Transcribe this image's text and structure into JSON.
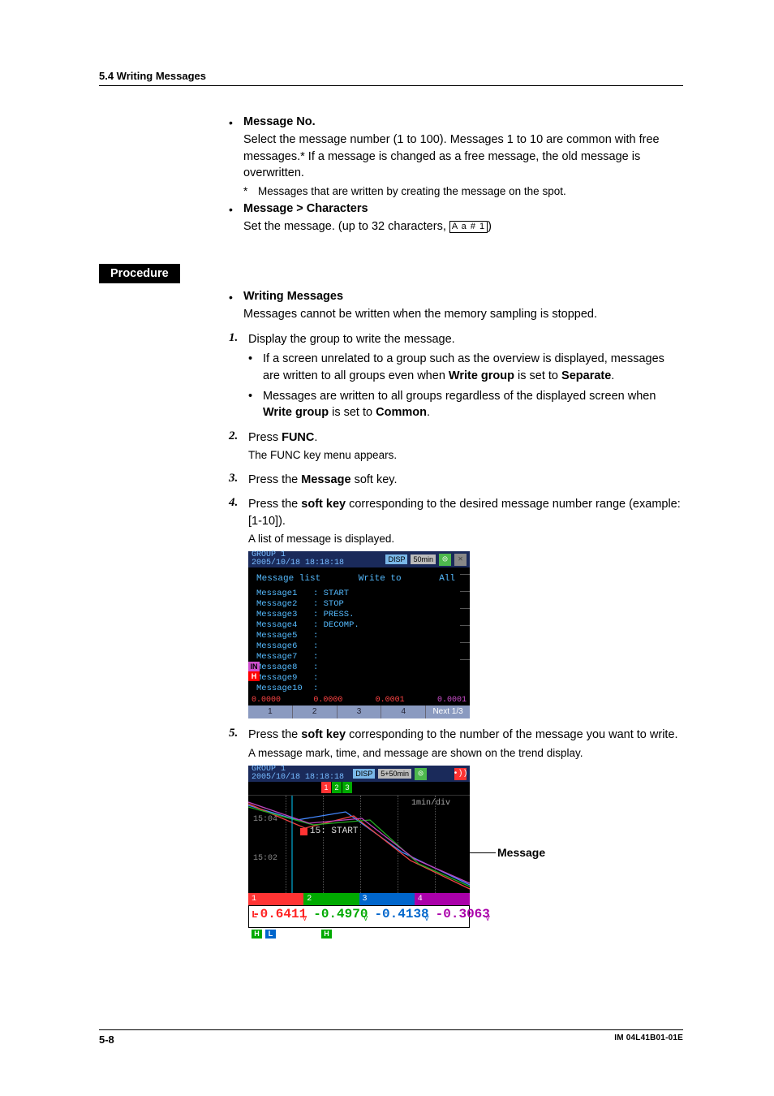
{
  "header": {
    "section": "5.4  Writing Messages"
  },
  "msgno": {
    "title": "Message No.",
    "body": "Select the message number (1 to 100). Messages 1 to 10 are common with free messages.* If a message is changed as a free message, the old message is overwritten.",
    "footnote_mark": "*",
    "footnote": "Messages that are written by creating the message on the spot."
  },
  "msgchar": {
    "title": "Message > Characters",
    "body_pre": "Set the message. (up to 32 characters, ",
    "box": "A a # 1",
    "body_post": ")"
  },
  "procedure_label": "Procedure",
  "writing": {
    "title": "Writing Messages",
    "body": "Messages cannot be written when the memory sampling is stopped."
  },
  "steps": {
    "s1": {
      "num": "1.",
      "text": "Display the group to write the message.",
      "b1a": "If a screen unrelated to a group such as the overview is displayed, messages are written to all groups even when ",
      "b1b": "Write group",
      "b1c": " is set to ",
      "b1d": "Separate",
      "b1e": ".",
      "b2a": "Messages are written to all groups regardless of the displayed screen when ",
      "b2b": "Write group",
      "b2c": " is set to ",
      "b2d": "Common",
      "b2e": "."
    },
    "s2": {
      "num": "2.",
      "pre": "Press ",
      "k": "FUNC",
      "post": ".",
      "note": "The FUNC key menu appears."
    },
    "s3": {
      "num": "3.",
      "pre": "Press the ",
      "k": "Message",
      "post": " soft key."
    },
    "s4": {
      "num": "4.",
      "pre": "Press the ",
      "k": "soft key",
      "post": " corresponding to the desired message number range (example: [1-10]).",
      "note": "A list of message is displayed."
    },
    "s5": {
      "num": "5.",
      "pre": "Press the ",
      "k": "soft key",
      "post": " corresponding to the number of the message you want to write.",
      "note": "A message mark, time, and message are shown on the trend display."
    }
  },
  "shot1": {
    "group": "GROUP 1",
    "ts": "2005/10/18 18:18:18",
    "disp": "DISP",
    "span": "50min",
    "col_list": "Message list",
    "col_write": "Write to",
    "col_all": "All",
    "rows": [
      {
        "k": "Message1",
        "v": ": START"
      },
      {
        "k": "Message2",
        "v": ": STOP"
      },
      {
        "k": "Message3",
        "v": ": PRESS."
      },
      {
        "k": "Message4",
        "v": ": DECOMP."
      },
      {
        "k": "Message5",
        "v": ":"
      },
      {
        "k": "Message6",
        "v": ":"
      },
      {
        "k": "Message7",
        "v": ":"
      },
      {
        "k": "Message8",
        "v": ":"
      },
      {
        "k": "Message9",
        "v": ":"
      },
      {
        "k": "Message10",
        "v": ":"
      }
    ],
    "left_in": "IN",
    "left_h": "H",
    "vals": [
      "0.0000",
      "0.0000",
      "0.0001",
      "0.0001"
    ],
    "keys": [
      "1",
      "2",
      "3",
      "4",
      "Next 1/3"
    ]
  },
  "shot2": {
    "group": "GROUP 1",
    "ts": "2005/10/18 18:18:18",
    "disp": "DISP",
    "span": "5+50min",
    "tabs": [
      "1",
      "2",
      "3"
    ],
    "mindiv": "1min/div",
    "t1": "15:04",
    "t2": "15:02",
    "msg_time": "15:",
    "msg_text": "START",
    "chs": [
      "1",
      "2",
      "3",
      "4"
    ],
    "vals": [
      {
        "L": "L",
        "v": "-0.6411",
        "u": "V"
      },
      {
        "L": "",
        "v": "-0.4970",
        "u": "V"
      },
      {
        "L": "",
        "v": "-0.4138",
        "u": "V"
      },
      {
        "L": "",
        "v": "-0.3063",
        "u": "V"
      }
    ],
    "hl": [
      "H",
      "L",
      "",
      "H"
    ]
  },
  "callout_message": "Message",
  "footer": {
    "page": "5-8",
    "doc": "IM 04L41B01-01E"
  },
  "chart_data": {
    "type": "line",
    "title": "GROUP 1 trend",
    "xlabel": "time",
    "ylabel": "V",
    "time_per_div": "1min/div",
    "gridline_times": [
      "15:04",
      "15:02"
    ],
    "message_marker": {
      "time_prefix": "15:",
      "text": "START"
    },
    "series": [
      {
        "name": "CH1",
        "color": "#ff2222",
        "latest_value": -0.6411,
        "unit": "V"
      },
      {
        "name": "CH2",
        "color": "#00aa00",
        "latest_value": -0.497,
        "unit": "V"
      },
      {
        "name": "CH3",
        "color": "#0066cc",
        "latest_value": -0.4138,
        "unit": "V"
      },
      {
        "name": "CH4",
        "color": "#aa00aa",
        "latest_value": -0.3063,
        "unit": "V"
      }
    ]
  }
}
